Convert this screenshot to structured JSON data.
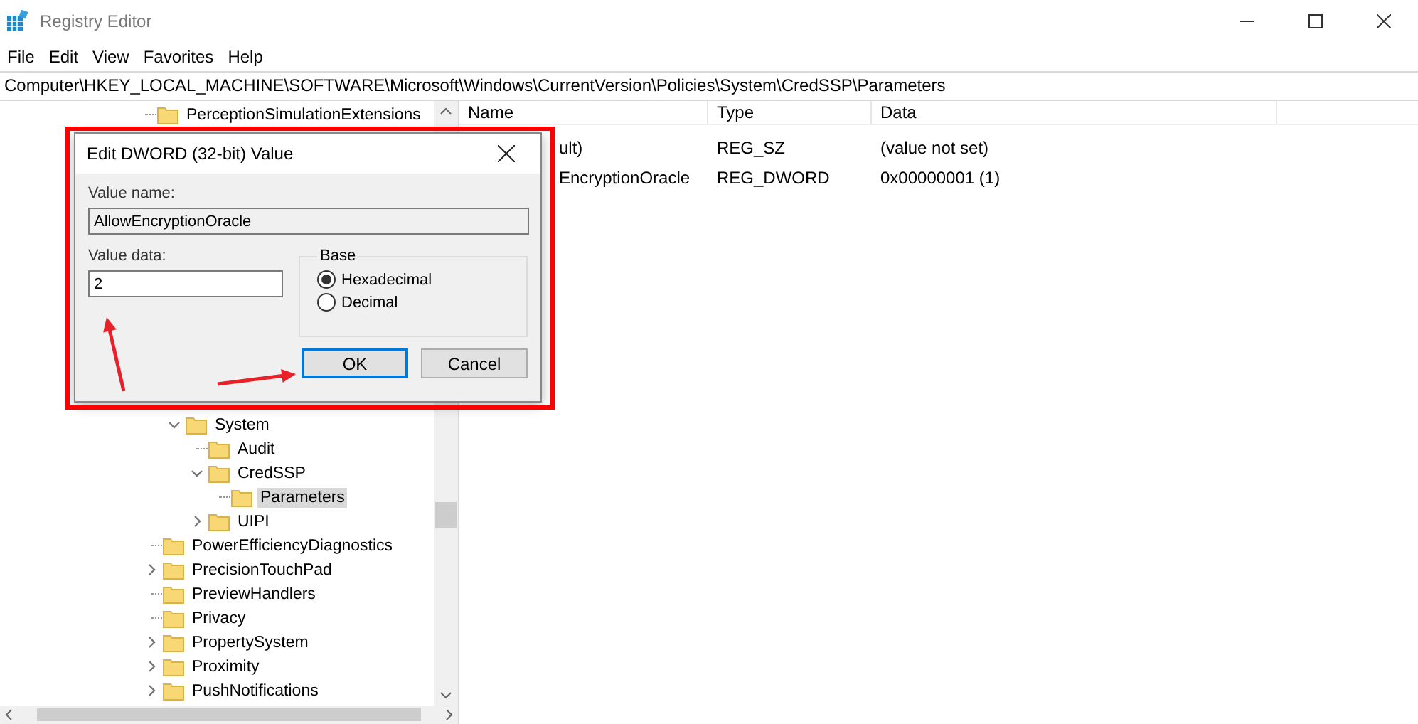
{
  "window": {
    "title": "Registry Editor"
  },
  "menu": [
    "File",
    "Edit",
    "View",
    "Favorites",
    "Help"
  ],
  "address": "Computer\\HKEY_LOCAL_MACHINE\\SOFTWARE\\Microsoft\\Windows\\CurrentVersion\\Policies\\System\\CredSSP\\Parameters",
  "tree": {
    "top": [
      {
        "label": "PerceptionSimulationExtensions",
        "kind": "leaf",
        "selected": false
      }
    ],
    "branch": [
      {
        "label": "System",
        "kind": "branch",
        "expanded": true,
        "selected": false,
        "children": [
          {
            "label": "Audit",
            "kind": "leaf",
            "selected": false
          },
          {
            "label": "CredSSP",
            "kind": "branch",
            "expanded": true,
            "selected": false,
            "children": [
              {
                "label": "Parameters",
                "kind": "leaf",
                "selected": true
              }
            ]
          },
          {
            "label": "UIPI",
            "kind": "branch",
            "expanded": false,
            "selected": false
          }
        ]
      }
    ],
    "after": [
      {
        "label": "PowerEfficiencyDiagnostics",
        "kind": "leaf",
        "selected": false
      },
      {
        "label": "PrecisionTouchPad",
        "kind": "branch",
        "expanded": false,
        "selected": false
      },
      {
        "label": "PreviewHandlers",
        "kind": "leaf",
        "selected": false
      },
      {
        "label": "Privacy",
        "kind": "leaf",
        "selected": false
      },
      {
        "label": "PropertySystem",
        "kind": "branch",
        "expanded": false,
        "selected": false
      },
      {
        "label": "Proximity",
        "kind": "branch",
        "expanded": false,
        "selected": false
      },
      {
        "label": "PushNotifications",
        "kind": "branch",
        "expanded": false,
        "selected": false
      }
    ]
  },
  "list": {
    "columns": [
      "Name",
      "Type",
      "Data"
    ],
    "rows": [
      {
        "name": "ult)",
        "type": "REG_SZ",
        "data": "(value not set)"
      },
      {
        "name": "EncryptionOracle",
        "type": "REG_DWORD",
        "data": "0x00000001 (1)"
      }
    ]
  },
  "dialog": {
    "title": "Edit DWORD (32-bit) Value",
    "value_name_label": "Value name:",
    "value_name": "AllowEncryptionOracle",
    "value_data_label": "Value data:",
    "value_data": "2",
    "base_label": "Base",
    "radios": [
      {
        "label": "Hexadecimal",
        "selected": true
      },
      {
        "label": "Decimal",
        "selected": false
      }
    ],
    "buttons": [
      {
        "label": "OK",
        "default": true
      },
      {
        "label": "Cancel",
        "default": false
      }
    ]
  }
}
